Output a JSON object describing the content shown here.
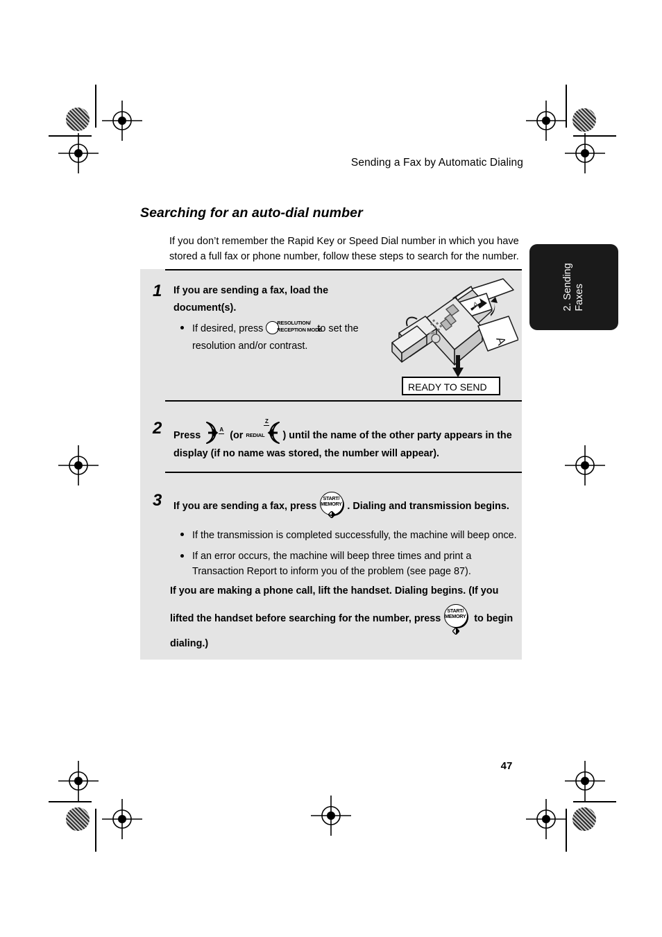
{
  "header": {
    "running_head": "Sending a Fax by Automatic Dialing"
  },
  "section": {
    "heading": "Searching for an auto-dial number",
    "intro": "If you don’t remember the Rapid Key or Speed Dial number in which you have stored a full fax or phone number, follow these steps to search for the number."
  },
  "side_tab": {
    "line1": "2. Sending",
    "line2": "Faxes"
  },
  "steps": {
    "step1": {
      "number": "1",
      "title": "If you are sending a fax, load the document(s).",
      "bullet_pre": "If desired, press",
      "bullet_post": "to set the resolution and/or contrast.",
      "key_resolution": {
        "line1": "RESOLUTION/",
        "line2": "RECEPTION MODE"
      }
    },
    "step2": {
      "number": "2",
      "press_label": "Press",
      "or_label": "(or",
      "redial_label": "REDIAL",
      "up_letter": "A",
      "down_letter": "Z",
      "tail": ") until the name of the other party appears in the display (if no name was stored, the number will appear)."
    },
    "step3": {
      "number": "3",
      "lead": "If you are sending a fax, press",
      "after_key": ". Dialing and transmission begins.",
      "bullet1": "If the transmission is completed successfully, the machine will beep once.",
      "bullet2": "If an error occurs, the machine will beep three times and print a Transaction Report to inform you of the problem (see page 87).",
      "note_part1": "If you are making a phone call, lift the handset. Dialing begins. (If you lifted the handset before searching for the number, press",
      "note_part2": "to begin dialing.)",
      "key_start": {
        "line1": "START/",
        "line2": "MEMORY"
      }
    }
  },
  "illustration": {
    "display_text": "READY TO SEND"
  },
  "footer": {
    "page_number": "47"
  },
  "colors": {
    "panel_gray": "#e4e4e4",
    "tab_black": "#1a1a1a",
    "ink": "#000000"
  }
}
